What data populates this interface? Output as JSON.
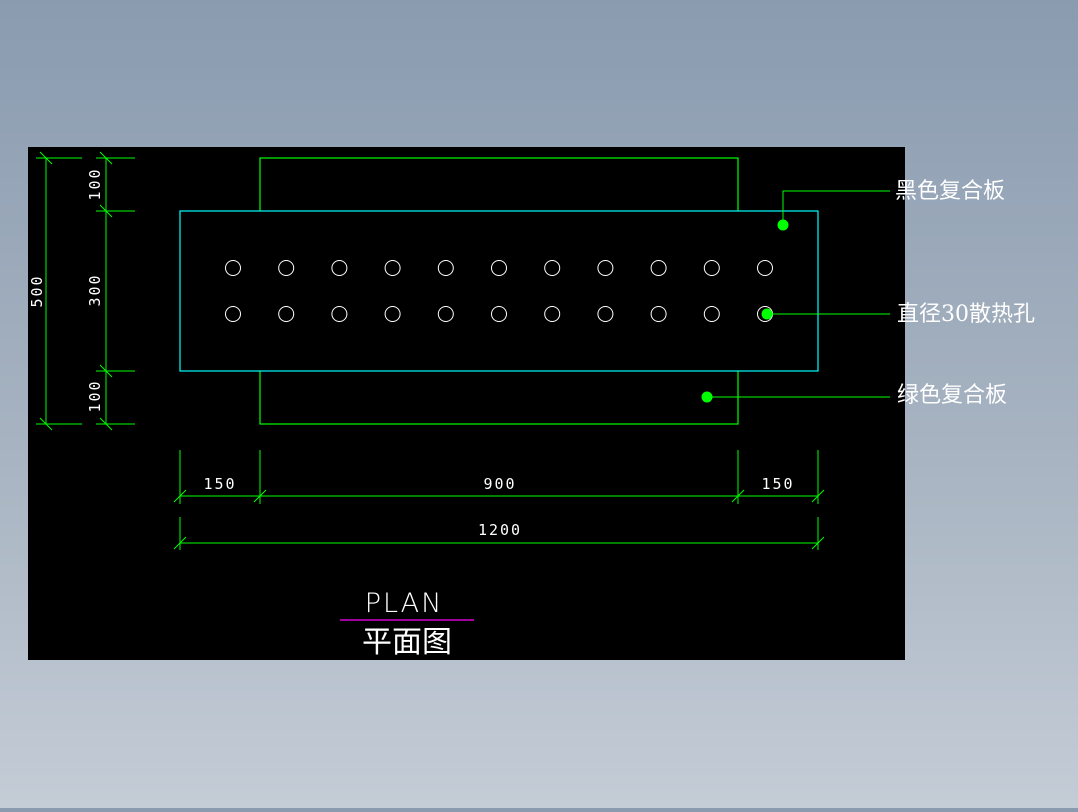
{
  "drawing": {
    "callouts": {
      "black_panel": "黑色复合板",
      "holes": "直径30散热孔",
      "green_panel": "绿色复合板"
    },
    "dimensions": {
      "total_height": "500",
      "top_margin": "100",
      "middle": "300",
      "bottom_margin": "100",
      "left_margin": "150",
      "center_width": "900",
      "right_margin": "150",
      "total_width": "1200"
    },
    "title": {
      "english": "PLAN",
      "chinese": "平面图"
    },
    "holes": {
      "rows": 2,
      "columns": 11
    },
    "colors": {
      "background": "#000000",
      "outer_panel": "#00ff00",
      "inner_panel": "#00ffff",
      "dimension": "#00ff00",
      "callout_dot": "#00ff00",
      "title_underline": "#ff00ff",
      "text": "#ffffff"
    }
  }
}
